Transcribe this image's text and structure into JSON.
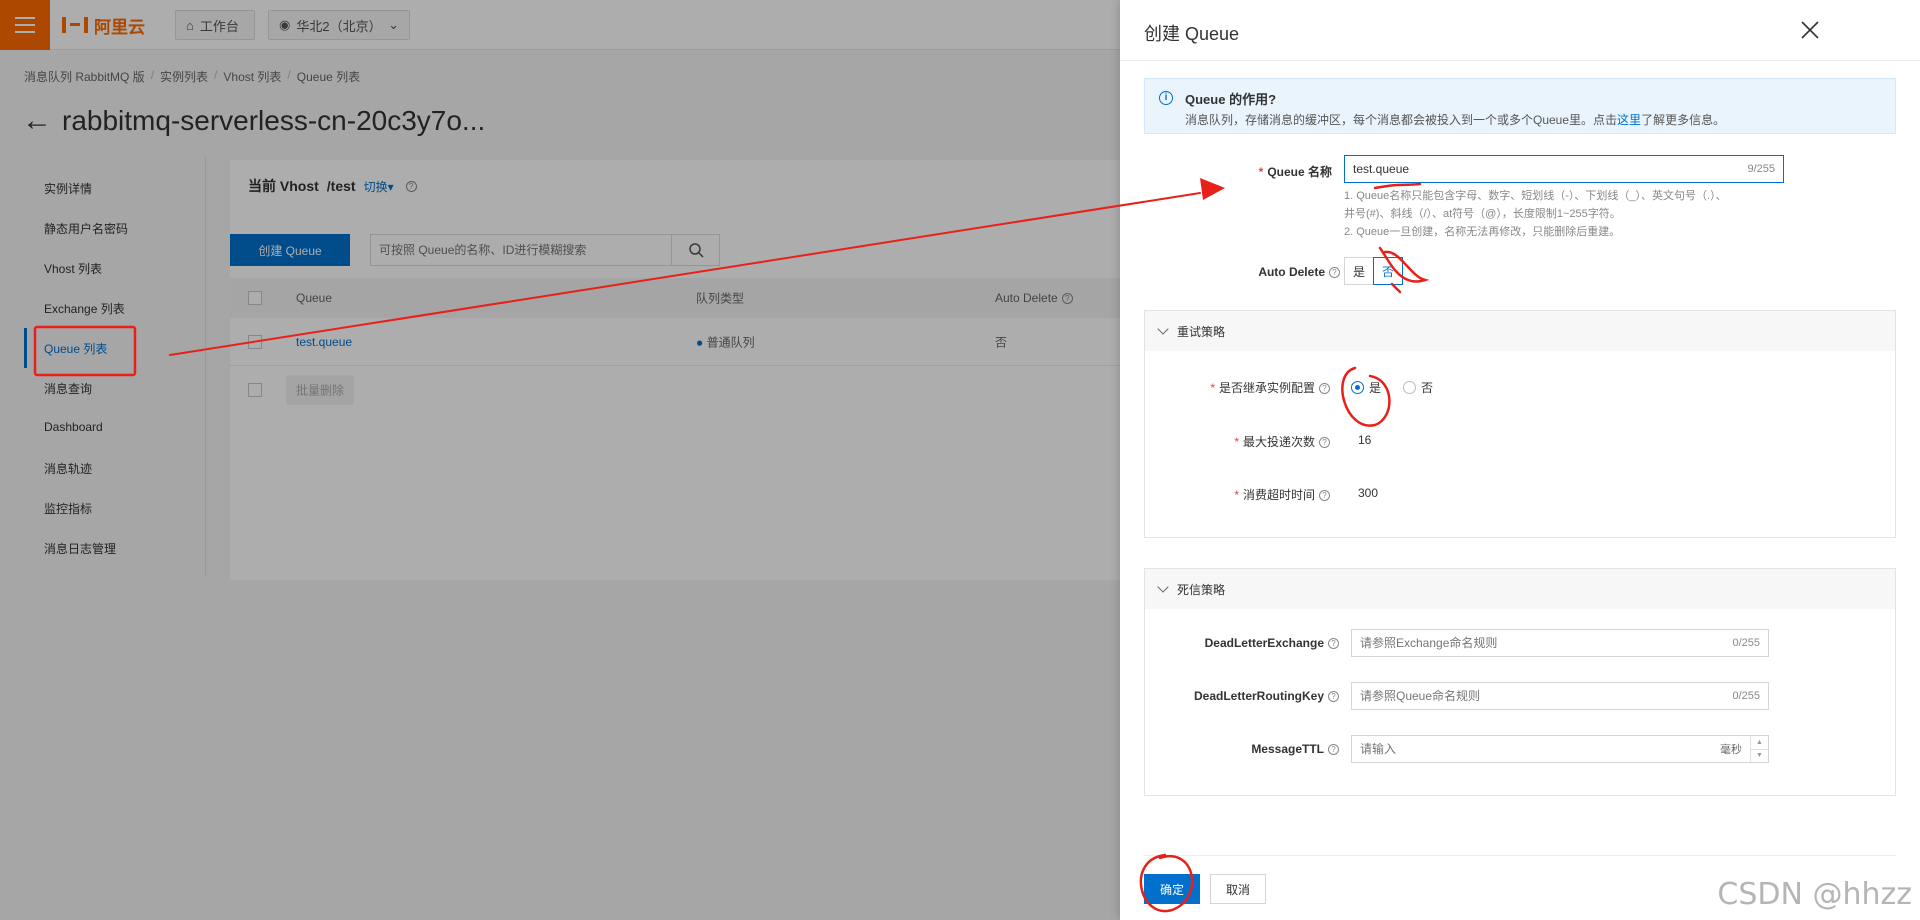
{
  "topbar": {
    "logo_text": "阿里云",
    "workbench": "工作台",
    "region": "华北2（北京）"
  },
  "breadcrumb": [
    "消息队列 RabbitMQ 版",
    "实例列表",
    "Vhost 列表",
    "Queue 列表"
  ],
  "page_title": "rabbitmq-serverless-cn-20c3y7o...",
  "nav": {
    "items": [
      "实例详情",
      "静态用户名密码",
      "Vhost 列表",
      "Exchange 列表",
      "Queue 列表",
      "消息查询",
      "Dashboard",
      "消息轨迹",
      "监控指标",
      "消息日志管理"
    ],
    "active": "Queue 列表"
  },
  "main": {
    "vhost_label": "当前 Vhost",
    "vhost_value": "/test",
    "switch_label": "切换",
    "create_button": "创建 Queue",
    "search_placeholder": "可按照 Queue的名称、ID进行模糊搜索",
    "columns": [
      "Queue",
      "队列类型",
      "Auto Delete"
    ],
    "rows": [
      {
        "queue": "test.queue",
        "type": "普通队列",
        "auto_delete": "否"
      }
    ],
    "batch_delete": "批量删除"
  },
  "drawer": {
    "title": "创建 Queue",
    "info_title": "Queue 的作用?",
    "info_text_before": "消息队列，存储消息的缓冲区，每个消息都会被投入到一个或多个Queue里。点击",
    "info_link": "这里",
    "info_text_after": "了解更多信息。",
    "queue_name_label": "Queue 名称",
    "queue_name_value": "test.queue",
    "queue_name_count": "9/255",
    "hint_1": "1. Queue名称只能包含字母、数字、短划线（-）、下划线（_）、英文句号（.）、",
    "hint_1b": "井号(#)、斜线（/）、at符号（@），长度限制1~255字符。",
    "hint_2": "2. Queue一旦创建，名称无法再修改，只能删除后重建。",
    "auto_delete_label": "Auto Delete",
    "auto_delete_yes": "是",
    "auto_delete_no": "否",
    "retry_section": "重试策略",
    "inherit_label": "是否继承实例配置",
    "inherit_yes": "是",
    "inherit_no": "否",
    "max_delivery_label": "最大投递次数",
    "max_delivery_value": "16",
    "consume_timeout_label": "消费超时时间",
    "consume_timeout_value": "300",
    "dead_letter_section": "死信策略",
    "dle_label": "DeadLetterExchange",
    "dle_placeholder": "请参照Exchange命名规则",
    "dle_count": "0/255",
    "dlrk_label": "DeadLetterRoutingKey",
    "dlrk_placeholder": "请参照Queue命名规则",
    "dlrk_count": "0/255",
    "ttl_label": "MessageTTL",
    "ttl_placeholder": "请输入",
    "ttl_unit": "毫秒",
    "ok_button": "确定",
    "cancel_button": "取消"
  },
  "watermark": "CSDN @hhzz",
  "colors": {
    "accent": "#0070cc",
    "brand": "#ff6a00",
    "annotation": "#e8201a"
  }
}
